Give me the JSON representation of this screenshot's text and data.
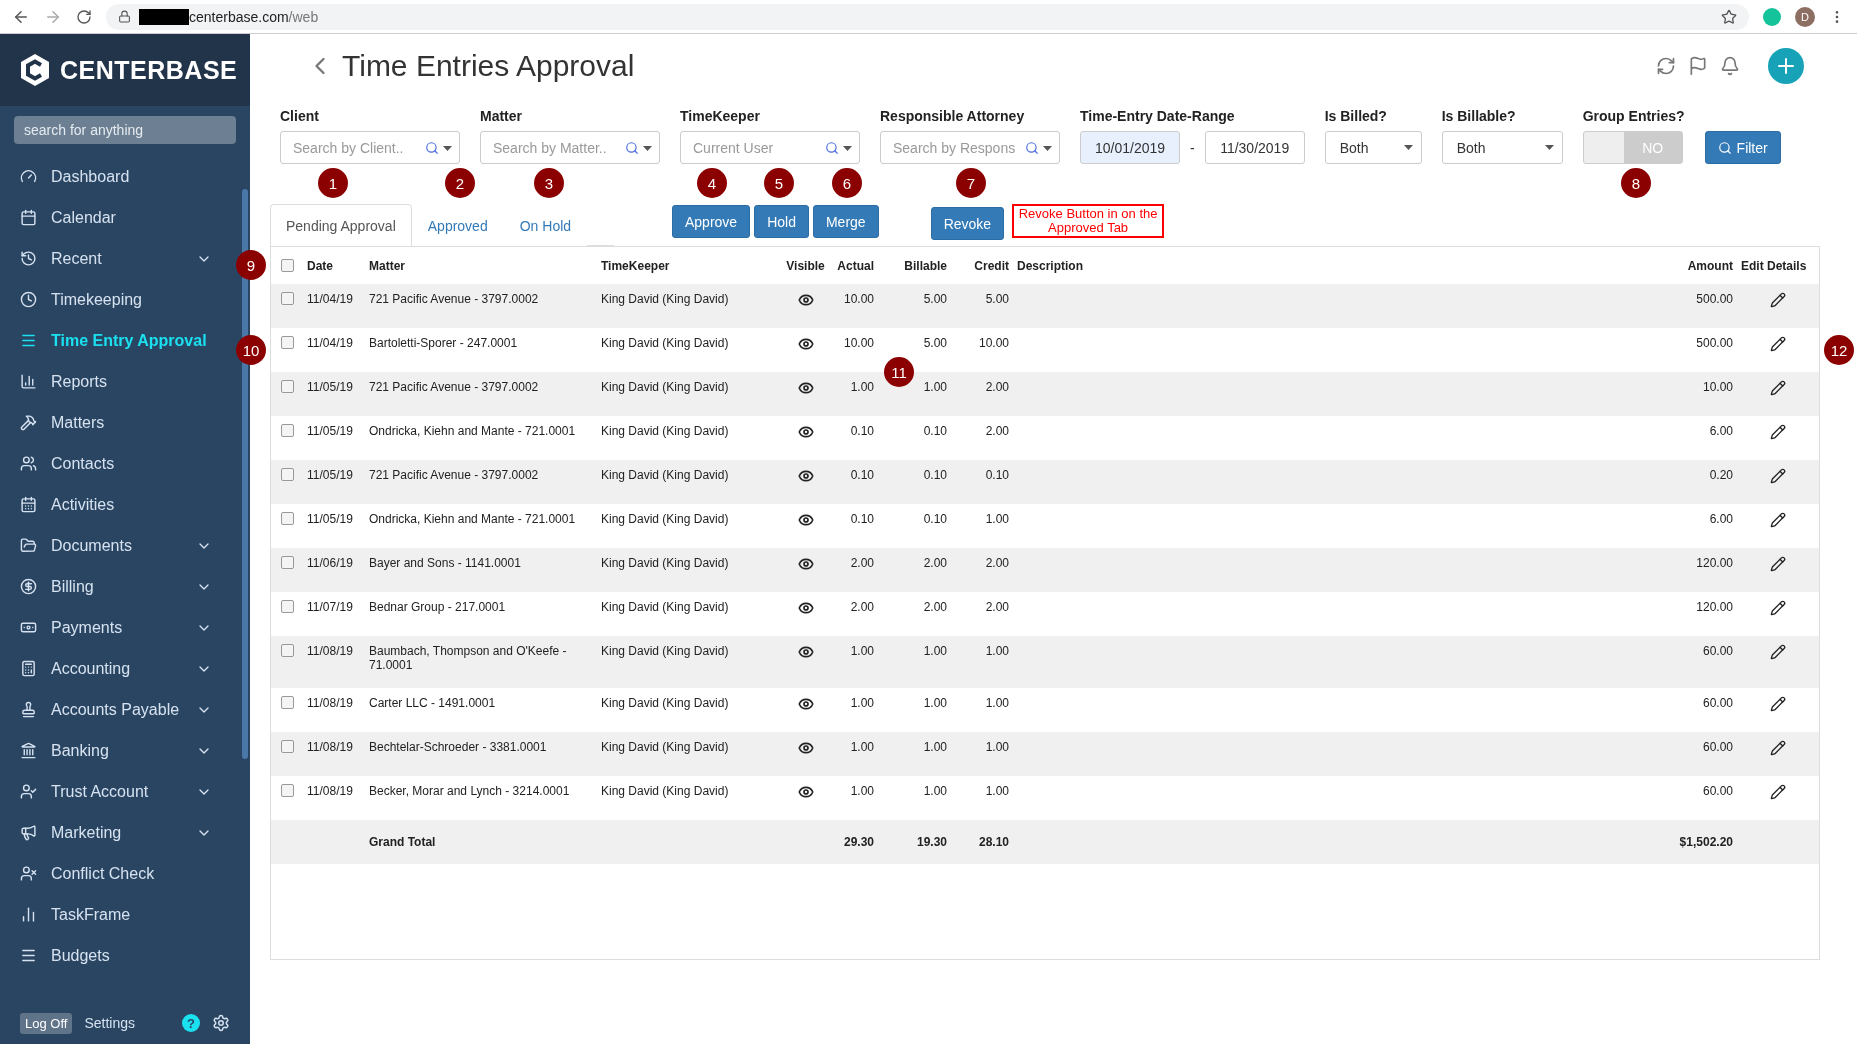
{
  "browser": {
    "url_host": "centerbase.com",
    "url_path": "/web",
    "profile_initial": "D"
  },
  "sidebar": {
    "brand": "CENTERBASE",
    "search_placeholder": "search for anything",
    "items": [
      {
        "label": "Dashboard",
        "selected": false,
        "expandable": false
      },
      {
        "label": "Calendar",
        "selected": false,
        "expandable": false
      },
      {
        "label": "Recent",
        "selected": false,
        "expandable": true
      },
      {
        "label": "Timekeeping",
        "selected": false,
        "expandable": false
      },
      {
        "label": "Time Entry Approval",
        "selected": true,
        "expandable": false
      },
      {
        "label": "Reports",
        "selected": false,
        "expandable": false
      },
      {
        "label": "Matters",
        "selected": false,
        "expandable": false
      },
      {
        "label": "Contacts",
        "selected": false,
        "expandable": false
      },
      {
        "label": "Activities",
        "selected": false,
        "expandable": false
      },
      {
        "label": "Documents",
        "selected": false,
        "expandable": true
      },
      {
        "label": "Billing",
        "selected": false,
        "expandable": true
      },
      {
        "label": "Payments",
        "selected": false,
        "expandable": true
      },
      {
        "label": "Accounting",
        "selected": false,
        "expandable": true
      },
      {
        "label": "Accounts Payable",
        "selected": false,
        "expandable": true
      },
      {
        "label": "Banking",
        "selected": false,
        "expandable": true
      },
      {
        "label": "Trust Account",
        "selected": false,
        "expandable": true
      },
      {
        "label": "Marketing",
        "selected": false,
        "expandable": true
      },
      {
        "label": "Conflict Check",
        "selected": false,
        "expandable": false
      },
      {
        "label": "TaskFrame",
        "selected": false,
        "expandable": false
      },
      {
        "label": "Budgets",
        "selected": false,
        "expandable": false
      }
    ],
    "footer": {
      "logoff": "Log Off",
      "settings": "Settings",
      "help": "?"
    }
  },
  "page": {
    "title": "Time Entries Approval"
  },
  "filters": [
    {
      "kind": "search",
      "label": "Client",
      "placeholder": "Search by Client.."
    },
    {
      "kind": "search",
      "label": "Matter",
      "placeholder": "Search by Matter.."
    },
    {
      "kind": "search",
      "label": "TimeKeeper",
      "placeholder": "Current User"
    },
    {
      "kind": "search",
      "label": "Responsible Attorney",
      "placeholder": "Search by Respons"
    },
    {
      "kind": "daterange",
      "label": "Time-Entry Date-Range",
      "from": "10/01/2019",
      "separator": "-",
      "to": "11/30/2019"
    },
    {
      "kind": "select",
      "label": "Is Billed?",
      "value": "Both"
    },
    {
      "kind": "select",
      "label": "Is Billable?",
      "value": "Both"
    },
    {
      "kind": "toggle",
      "label": "Group Entries?",
      "on": false,
      "state_text": "NO"
    }
  ],
  "filter_button": "Filter",
  "tabs": [
    {
      "label": "Pending Approval",
      "selected": true
    },
    {
      "label": "Approved",
      "selected": false
    },
    {
      "label": "On Hold",
      "selected": false
    }
  ],
  "actions": [
    "Approve",
    "Hold",
    "Merge"
  ],
  "revoke_button": "Revoke",
  "note": "Revoke Button in on the Approved Tab",
  "table": {
    "columns": [
      "Date",
      "Matter",
      "TimeKeeper",
      "Visible",
      "Actual",
      "Billable",
      "Credit",
      "Description",
      "Amount",
      "Edit Details"
    ],
    "all_checked": false,
    "rows": [
      {
        "checked": false,
        "date": "11/04/19",
        "matter": "721 Pacific Avenue - 3797.0002",
        "timekeeper": "King David (King David)",
        "visible": true,
        "actual": "10.00",
        "billable": "5.00",
        "credit": "5.00",
        "amount": "500.00"
      },
      {
        "checked": false,
        "date": "11/04/19",
        "matter": "Bartoletti-Sporer - 247.0001",
        "timekeeper": "King David (King David)",
        "visible": true,
        "actual": "10.00",
        "billable": "5.00",
        "credit": "10.00",
        "amount": "500.00"
      },
      {
        "checked": false,
        "date": "11/05/19",
        "matter": "721 Pacific Avenue - 3797.0002",
        "timekeeper": "King David (King David)",
        "visible": true,
        "actual": "1.00",
        "billable": "1.00",
        "credit": "2.00",
        "amount": "10.00"
      },
      {
        "checked": false,
        "date": "11/05/19",
        "matter": "Ondricka, Kiehn and Mante - 721.0001",
        "timekeeper": "King David (King David)",
        "visible": true,
        "actual": "0.10",
        "billable": "0.10",
        "credit": "2.00",
        "amount": "6.00"
      },
      {
        "checked": false,
        "date": "11/05/19",
        "matter": "721 Pacific Avenue - 3797.0002",
        "timekeeper": "King David (King David)",
        "visible": true,
        "actual": "0.10",
        "billable": "0.10",
        "credit": "0.10",
        "amount": "0.20"
      },
      {
        "checked": false,
        "date": "11/05/19",
        "matter": "Ondricka, Kiehn and Mante - 721.0001",
        "timekeeper": "King David (King David)",
        "visible": true,
        "actual": "0.10",
        "billable": "0.10",
        "credit": "1.00",
        "amount": "6.00"
      },
      {
        "checked": false,
        "date": "11/06/19",
        "matter": "Bayer and Sons - 1141.0001",
        "timekeeper": "King David (King David)",
        "visible": true,
        "actual": "2.00",
        "billable": "2.00",
        "credit": "2.00",
        "amount": "120.00"
      },
      {
        "checked": false,
        "date": "11/07/19",
        "matter": "Bednar Group - 217.0001",
        "timekeeper": "King David (King David)",
        "visible": true,
        "actual": "2.00",
        "billable": "2.00",
        "credit": "2.00",
        "amount": "120.00"
      },
      {
        "checked": false,
        "date": "11/08/19",
        "matter": "Baumbach, Thompson and O'Keefe - 71.0001",
        "timekeeper": "King David (King David)",
        "visible": true,
        "actual": "1.00",
        "billable": "1.00",
        "credit": "1.00",
        "amount": "60.00"
      },
      {
        "checked": false,
        "date": "11/08/19",
        "matter": "Carter LLC - 1491.0001",
        "timekeeper": "King David (King David)",
        "visible": true,
        "actual": "1.00",
        "billable": "1.00",
        "credit": "1.00",
        "amount": "60.00"
      },
      {
        "checked": false,
        "date": "11/08/19",
        "matter": "Bechtelar-Schroeder - 3381.0001",
        "timekeeper": "King David (King David)",
        "visible": true,
        "actual": "1.00",
        "billable": "1.00",
        "credit": "1.00",
        "amount": "60.00"
      },
      {
        "checked": false,
        "date": "11/08/19",
        "matter": "Becker, Morar and Lynch - 3214.0001",
        "timekeeper": "King David (King David)",
        "visible": true,
        "actual": "1.00",
        "billable": "1.00",
        "credit": "1.00",
        "amount": "60.00"
      }
    ],
    "total": {
      "label": "Grand Total",
      "actual": "29.30",
      "billable": "19.30",
      "credit": "28.10",
      "amount": "$1,502.20"
    }
  },
  "annotations": [
    "1",
    "2",
    "3",
    "4",
    "5",
    "6",
    "7",
    "8",
    "9",
    "10",
    "11",
    "12"
  ]
}
